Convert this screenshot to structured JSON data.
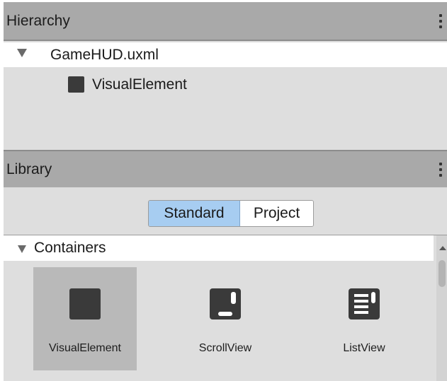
{
  "hierarchy": {
    "title": "Hierarchy",
    "root_item": "GameHUD.uxml",
    "child_item": "VisualElement"
  },
  "library": {
    "title": "Library",
    "tabs": [
      {
        "label": "Standard",
        "selected": true
      },
      {
        "label": "Project",
        "selected": false
      }
    ],
    "category": "Containers",
    "items": [
      {
        "label": "VisualElement",
        "icon": "visual-element-icon",
        "selected": true
      },
      {
        "label": "ScrollView",
        "icon": "scroll-view-icon",
        "selected": false
      },
      {
        "label": "ListView",
        "icon": "list-view-icon",
        "selected": false
      }
    ]
  },
  "colors": {
    "header_bg": "#a9a9a9",
    "panel_bg": "#dedede",
    "selected_tab": "#a7cdf1",
    "selected_tile": "#b9b9b9",
    "icon_dark": "#3a3a3a"
  }
}
